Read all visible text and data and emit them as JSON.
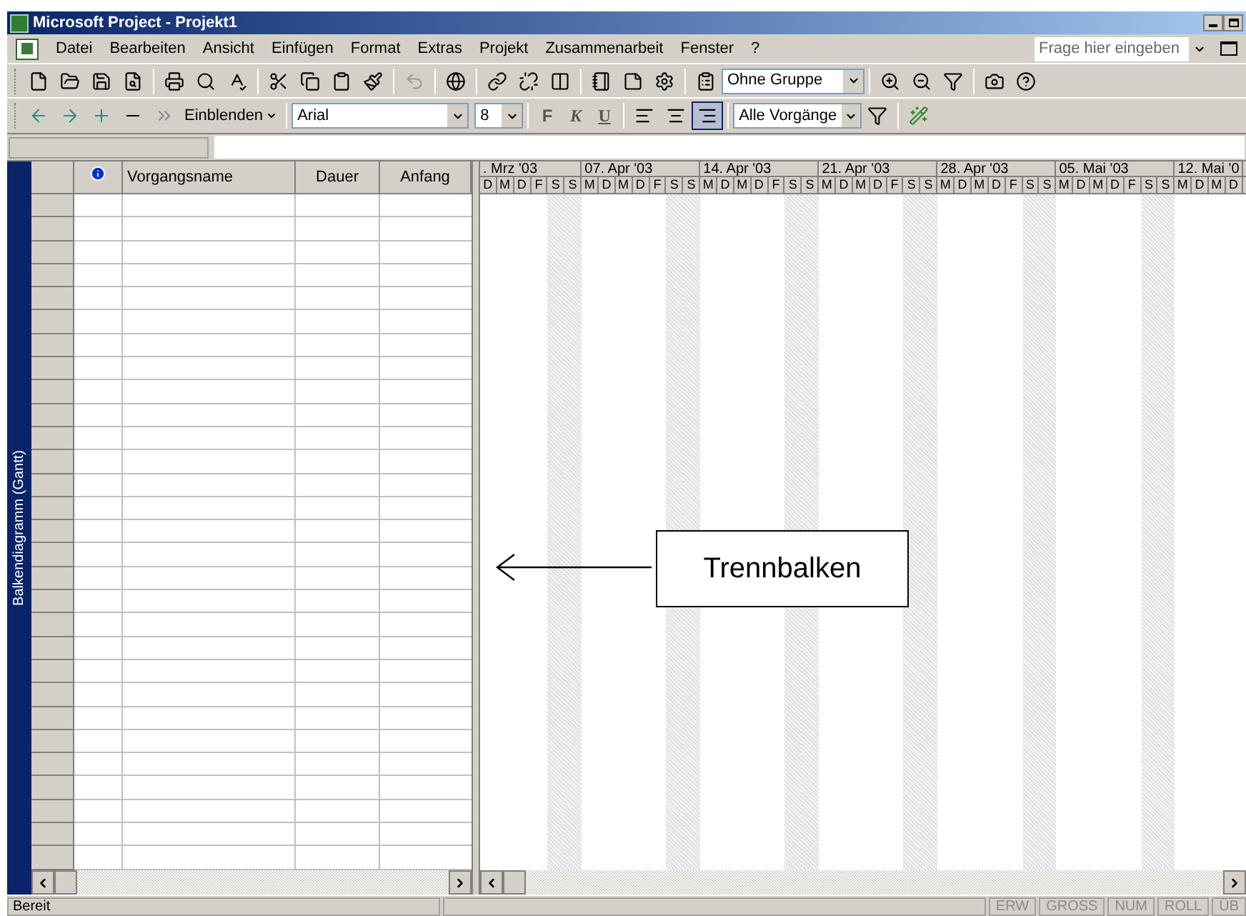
{
  "window": {
    "title": "Microsoft Project - Projekt1"
  },
  "menu": [
    "Datei",
    "Bearbeiten",
    "Ansicht",
    "Einfügen",
    "Format",
    "Extras",
    "Projekt",
    "Zusammenarbeit",
    "Fenster",
    "?"
  ],
  "help_search": {
    "placeholder": "Frage hier eingeben"
  },
  "standard_toolbar": {
    "group_select": "Ohne Gruppe"
  },
  "format_toolbar": {
    "outline_button": "Einblenden",
    "font": "Arial",
    "size": "8",
    "bold": "F",
    "italic": "K",
    "underline": "U",
    "align_buttons": [
      {
        "selected": false
      },
      {
        "selected": false
      },
      {
        "selected": true
      }
    ],
    "filter": "Alle Vorgänge"
  },
  "view_bar": {
    "label": "Balkendiagramm (Gantt)"
  },
  "table": {
    "columns": [
      "Vorgangsname",
      "Dauer",
      "Anfang"
    ]
  },
  "timescale": [
    {
      "label": ". Mrz '03",
      "days": [
        "D",
        "M",
        "D",
        "F",
        "S",
        "S"
      ]
    },
    {
      "label": "07. Apr '03",
      "days": [
        "M",
        "D",
        "M",
        "D",
        "F",
        "S",
        "S"
      ]
    },
    {
      "label": "14. Apr '03",
      "days": [
        "M",
        "D",
        "M",
        "D",
        "F",
        "S",
        "S"
      ]
    },
    {
      "label": "21. Apr '03",
      "days": [
        "M",
        "D",
        "M",
        "D",
        "F",
        "S",
        "S"
      ]
    },
    {
      "label": "28. Apr '03",
      "days": [
        "M",
        "D",
        "M",
        "D",
        "F",
        "S",
        "S"
      ]
    },
    {
      "label": "05. Mai '03",
      "days": [
        "M",
        "D",
        "M",
        "D",
        "F",
        "S",
        "S"
      ]
    },
    {
      "label": "12. Mai '0",
      "days": [
        "M",
        "D",
        "M",
        "D"
      ]
    }
  ],
  "callout": {
    "text": "Trennbalken"
  },
  "status_bar": {
    "text": "Bereit",
    "indicators": [
      "ERW",
      "GROSS",
      "NUM",
      "ROLL",
      "ÜB"
    ]
  }
}
